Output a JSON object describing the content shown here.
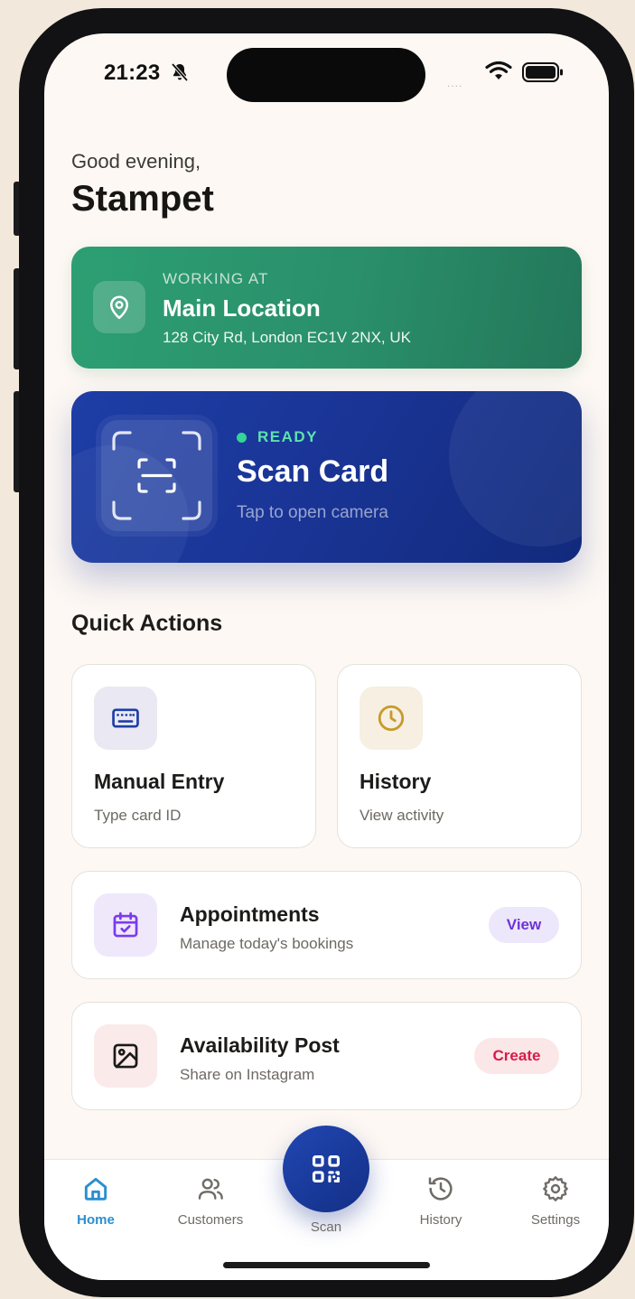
{
  "status_bar": {
    "time": "21:23",
    "signal": "....",
    "icons": [
      "bell-slash-icon",
      "wifi-icon",
      "battery-icon"
    ]
  },
  "header": {
    "greeting": "Good evening,",
    "name": "Stampet"
  },
  "location": {
    "overline": "WORKING AT",
    "name": "Main Location",
    "address": "128 City Rd, London EC1V 2NX, UK",
    "icon": "map-pin-icon",
    "color": "#2a9b71"
  },
  "scan": {
    "status": "READY",
    "title": "Scan Card",
    "subtitle": "Tap to open camera",
    "icon": "scan-frame-icon",
    "color": "#1c3aa2",
    "status_color": "#34d399"
  },
  "quick_actions": {
    "title": "Quick Actions",
    "tiles": [
      {
        "title": "Manual Entry",
        "subtitle": "Type card ID",
        "icon": "keyboard-icon",
        "bg": "#e9e8f3",
        "color": "#1e3ea5"
      },
      {
        "title": "History",
        "subtitle": "View activity",
        "icon": "clock-icon",
        "bg": "#f6efe2",
        "color": "#c79a2a"
      }
    ],
    "rows": [
      {
        "title": "Appointments",
        "subtitle": "Manage today's bookings",
        "action": "View",
        "icon": "calendar-check-icon",
        "bg": "#efe8fb",
        "color": "#7c3aed"
      },
      {
        "title": "Availability Post",
        "subtitle": "Share on Instagram",
        "action": "Create",
        "icon": "image-icon",
        "bg": "#fbeaea",
        "color": "#e11d48"
      }
    ]
  },
  "tab_bar": {
    "active": "Home",
    "active_color": "#2a8fd0",
    "tabs": [
      {
        "label": "Home",
        "icon": "home-icon"
      },
      {
        "label": "Customers",
        "icon": "users-icon"
      },
      {
        "label": "Scan",
        "icon": "qr-code-icon"
      },
      {
        "label": "History",
        "icon": "history-icon"
      },
      {
        "label": "Settings",
        "icon": "gear-icon"
      }
    ]
  }
}
